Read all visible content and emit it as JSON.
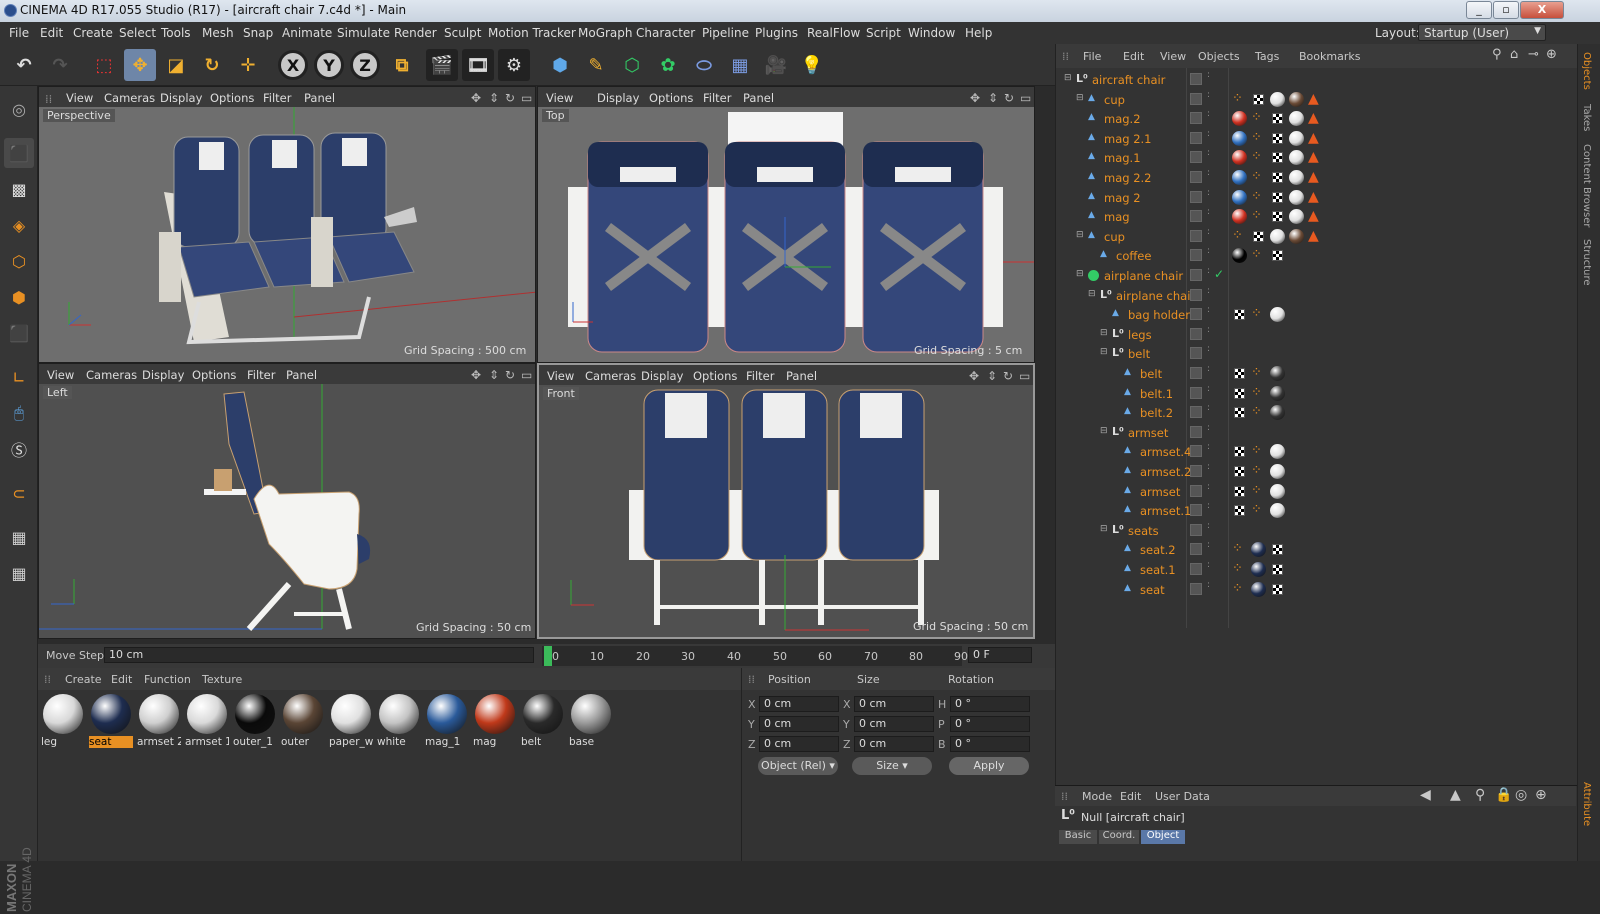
{
  "window": {
    "title": "CINEMA 4D R17.055 Studio (R17) - [aircraft chair 7.c4d *] - Main",
    "min": "_",
    "max": "▫",
    "close": "X"
  },
  "menu": [
    "File",
    "Edit",
    "Create",
    "Select",
    "Tools",
    "Mesh",
    "Snap",
    "Animate",
    "Simulate",
    "Render",
    "Sculpt",
    "Motion Tracker",
    "MoGraph",
    "Character",
    "Pipeline",
    "Plugins",
    "RealFlow",
    "Script",
    "Window",
    "Help"
  ],
  "layout": {
    "label": "Layout:",
    "value": "Startup (User)"
  },
  "toolbar": {
    "x": "X",
    "y": "Y",
    "z": "Z"
  },
  "viewports": {
    "menu": [
      "View",
      "Cameras",
      "Display",
      "Options",
      "Filter",
      "Panel"
    ],
    "perspective": {
      "name": "Perspective",
      "grid": "Grid Spacing : 500 cm"
    },
    "top": {
      "name": "Top",
      "grid": "Grid Spacing : 5 cm"
    },
    "left": {
      "name": "Left",
      "grid": "Grid Spacing : 50 cm"
    },
    "front": {
      "name": "Front",
      "grid": "Grid Spacing : 50 cm"
    }
  },
  "timeline": {
    "move_step_label": "Move Step",
    "move_step_value": "10 cm",
    "ticks": [
      "0",
      "10",
      "20",
      "30",
      "40",
      "50",
      "60",
      "70",
      "80",
      "90"
    ],
    "frame": "0 F"
  },
  "material_manager": {
    "menu": [
      "Create",
      "Edit",
      "Function",
      "Texture"
    ],
    "materials": [
      {
        "name": "leg",
        "color": "#d8d8d8"
      },
      {
        "name": "seat",
        "color": "#1e2d50"
      },
      {
        "name": "armset 2",
        "color": "#cfcfcf"
      },
      {
        "name": "armset 1",
        "color": "#d9d9d9"
      },
      {
        "name": "outer_1",
        "color": "#0a0a0a"
      },
      {
        "name": "outer",
        "color": "#5a4535"
      },
      {
        "name": "paper_w",
        "color": "#e0e0e0"
      },
      {
        "name": "white",
        "color": "#c4c4c4"
      },
      {
        "name": "mag_1",
        "color": "#2a5a9a"
      },
      {
        "name": "mag",
        "color": "#c0391a"
      },
      {
        "name": "belt",
        "color": "#2a2a2a"
      },
      {
        "name": "base",
        "color": "#9a9a9a"
      }
    ]
  },
  "coordinates": {
    "headers": [
      "Position",
      "Size",
      "Rotation"
    ],
    "rows": [
      {
        "axis": "X",
        "pos": "0 cm",
        "size_axis": "X",
        "size": "0 cm",
        "rot_axis": "H",
        "rot": "0 °"
      },
      {
        "axis": "Y",
        "pos": "0 cm",
        "size_axis": "Y",
        "size": "0 cm",
        "rot_axis": "P",
        "rot": "0 °"
      },
      {
        "axis": "Z",
        "pos": "0 cm",
        "size_axis": "Z",
        "size": "0 cm",
        "rot_axis": "B",
        "rot": "0 °"
      }
    ],
    "mode": "Object (Rel)",
    "size_mode": "Size",
    "apply": "Apply"
  },
  "object_manager": {
    "menu": [
      "File",
      "Edit",
      "View",
      "Objects",
      "Tags",
      "Bookmarks"
    ],
    "objects": [
      {
        "name": "aircraft chair",
        "tags": []
      },
      {
        "name": "cup",
        "tags": [
          "orange",
          "checker",
          "white",
          "brown",
          "warn"
        ]
      },
      {
        "name": "mag.2",
        "tags": [
          "red",
          "orange",
          "checker",
          "white",
          "warn"
        ]
      },
      {
        "name": "mag 2.1",
        "tags": [
          "blue",
          "orange",
          "checker",
          "white",
          "warn"
        ]
      },
      {
        "name": "mag.1",
        "tags": [
          "red",
          "orange",
          "checker",
          "white",
          "warn"
        ]
      },
      {
        "name": "mag 2.2",
        "tags": [
          "blue",
          "orange",
          "checker",
          "white",
          "warn"
        ]
      },
      {
        "name": "mag 2",
        "tags": [
          "blue",
          "orange",
          "checker",
          "white",
          "warn"
        ]
      },
      {
        "name": "mag",
        "tags": [
          "red",
          "orange",
          "checker",
          "white",
          "warn"
        ]
      },
      {
        "name": "cup",
        "tags": [
          "orange",
          "checker",
          "white",
          "brown",
          "warn"
        ]
      },
      {
        "name": "coffee",
        "tags": [
          "black",
          "orange",
          "checker"
        ]
      },
      {
        "name": "airplane chair",
        "tags": []
      },
      {
        "name": "airplane chair",
        "tags": []
      },
      {
        "name": "bag holder",
        "tags": [
          "checker",
          "orange",
          "white"
        ]
      },
      {
        "name": "legs",
        "tags": []
      },
      {
        "name": "belt",
        "tags": []
      },
      {
        "name": "belt",
        "tags": [
          "checker",
          "orange",
          "dark"
        ]
      },
      {
        "name": "belt.1",
        "tags": [
          "checker",
          "orange",
          "dark"
        ]
      },
      {
        "name": "belt.2",
        "tags": [
          "checker",
          "orange",
          "dark"
        ]
      },
      {
        "name": "armset",
        "tags": []
      },
      {
        "name": "armset.4",
        "tags": [
          "checker",
          "orange",
          "white"
        ]
      },
      {
        "name": "armset.2",
        "tags": [
          "checker",
          "orange",
          "white"
        ]
      },
      {
        "name": "armset",
        "tags": [
          "checker",
          "orange",
          "white"
        ]
      },
      {
        "name": "armset.1",
        "tags": [
          "checker",
          "orange",
          "white"
        ]
      },
      {
        "name": "seats",
        "tags": []
      },
      {
        "name": "seat.2",
        "tags": [
          "orange",
          "navy",
          "checker"
        ]
      },
      {
        "name": "seat.1",
        "tags": [
          "orange",
          "navy",
          "checker"
        ]
      },
      {
        "name": "seat",
        "tags": [
          "orange",
          "navy",
          "checker"
        ]
      }
    ]
  },
  "attributes": {
    "menu": [
      "Mode",
      "Edit",
      "User Data"
    ],
    "selected": "Null [aircraft chair]",
    "tabs": [
      "Basic",
      "Coord.",
      "Object"
    ]
  },
  "side_tabs": [
    "Objects",
    "Takes",
    "Content Browser",
    "Structure",
    "Attribute"
  ],
  "maxon": "MAXON",
  "cinema": "CINEMA 4D"
}
